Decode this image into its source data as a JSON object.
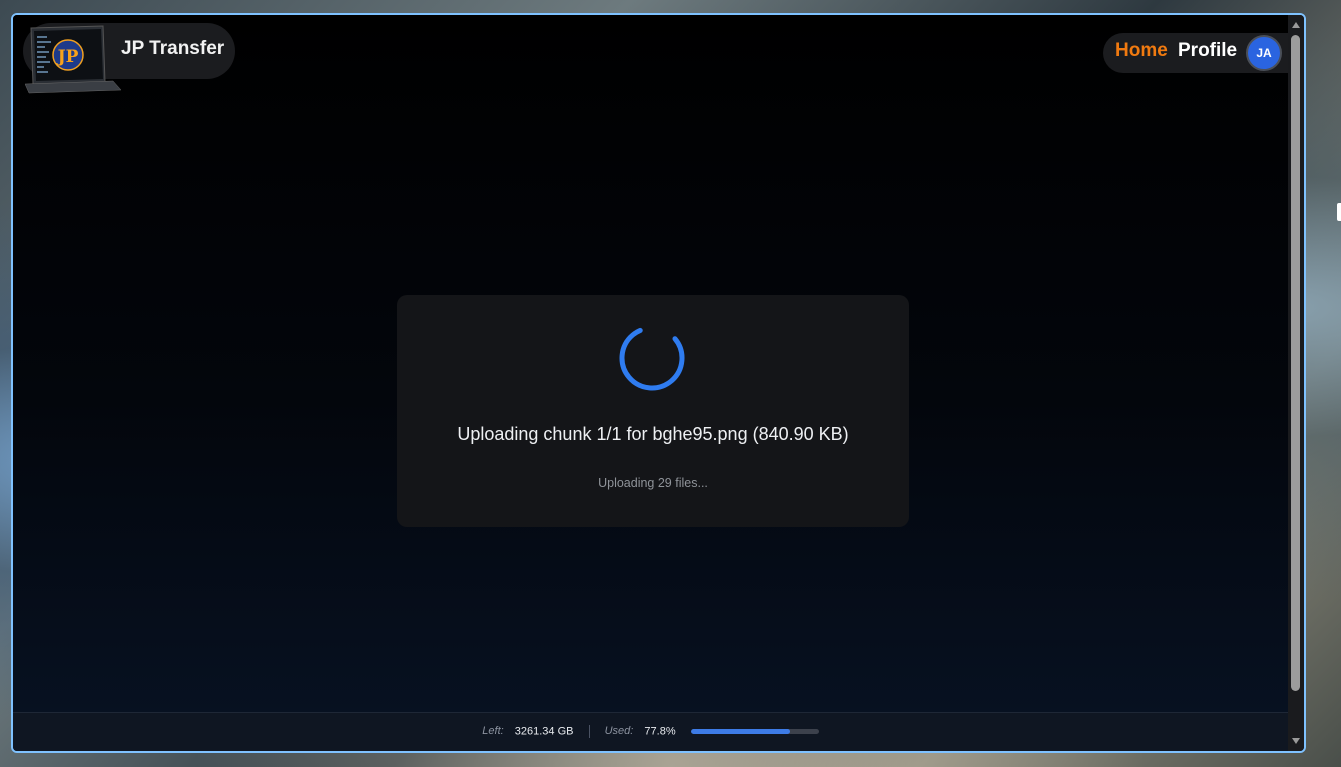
{
  "app": {
    "title": "JP Transfer",
    "logo_text": "JP"
  },
  "nav": {
    "home_label": "Home",
    "profile_label": "Profile",
    "avatar_initials": "JA",
    "home_color": "#f07a10",
    "avatar_color": "#2a64e0"
  },
  "upload": {
    "status": "Uploading chunk 1/1 for bghe95.png (840.90 KB)",
    "subtext": "Uploading 29 files...",
    "spinner_color": "#2f7cf0"
  },
  "footer": {
    "left_label": "Left:",
    "left_value": "3261.34 GB",
    "used_label": "Used:",
    "used_value": "77.8%",
    "used_fraction": 0.778,
    "bar_color": "#3d7be6"
  },
  "accent": {
    "window_border": "#7fc2ff"
  }
}
